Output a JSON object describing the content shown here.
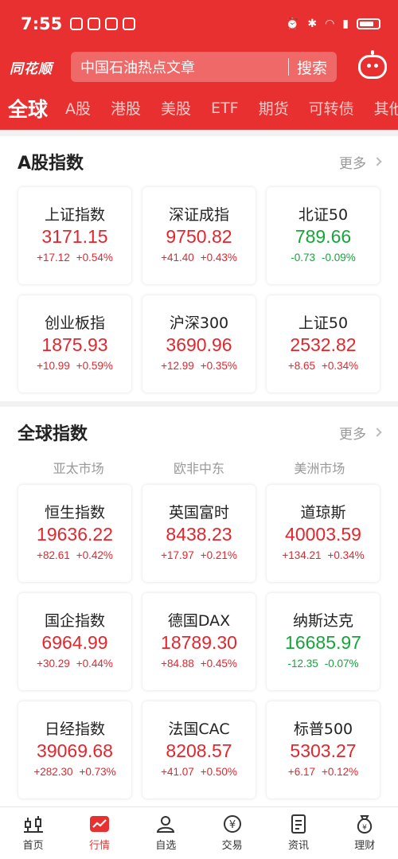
{
  "status_bar": {
    "time": "7:55"
  },
  "header": {
    "logo": "同花顺",
    "search_placeholder": "中国石油热点文章",
    "search_button": "搜索"
  },
  "tabs": [
    "全球",
    "A股",
    "港股",
    "美股",
    "ETF",
    "期货",
    "可转债",
    "其他"
  ],
  "a_share": {
    "title": "A股指数",
    "more": "更多",
    "cards": [
      {
        "name": "上证指数",
        "value": "3171.15",
        "change": "+17.12",
        "pct": "+0.54%",
        "dir": "up"
      },
      {
        "name": "深证成指",
        "value": "9750.82",
        "change": "+41.40",
        "pct": "+0.43%",
        "dir": "up"
      },
      {
        "name": "北证50",
        "value": "789.66",
        "change": "-0.73",
        "pct": "-0.09%",
        "dir": "down"
      },
      {
        "name": "创业板指",
        "value": "1875.93",
        "change": "+10.99",
        "pct": "+0.59%",
        "dir": "up"
      },
      {
        "name": "沪深300",
        "value": "3690.96",
        "change": "+12.99",
        "pct": "+0.35%",
        "dir": "up"
      },
      {
        "name": "上证50",
        "value": "2532.82",
        "change": "+8.65",
        "pct": "+0.34%",
        "dir": "up"
      }
    ]
  },
  "global": {
    "title": "全球指数",
    "more": "更多",
    "regions": [
      "亚太市场",
      "欧非中东",
      "美洲市场"
    ],
    "cards": [
      {
        "name": "恒生指数",
        "value": "19636.22",
        "change": "+82.61",
        "pct": "+0.42%",
        "dir": "up"
      },
      {
        "name": "英国富时",
        "value": "8438.23",
        "change": "+17.97",
        "pct": "+0.21%",
        "dir": "up"
      },
      {
        "name": "道琼斯",
        "value": "40003.59",
        "change": "+134.21",
        "pct": "+0.34%",
        "dir": "up"
      },
      {
        "name": "国企指数",
        "value": "6964.99",
        "change": "+30.29",
        "pct": "+0.44%",
        "dir": "up"
      },
      {
        "name": "德国DAX",
        "value": "18789.30",
        "change": "+84.88",
        "pct": "+0.45%",
        "dir": "up"
      },
      {
        "name": "纳斯达克",
        "value": "16685.97",
        "change": "-12.35",
        "pct": "-0.07%",
        "dir": "down"
      },
      {
        "name": "日经指数",
        "value": "39069.68",
        "change": "+282.30",
        "pct": "+0.73%",
        "dir": "up"
      },
      {
        "name": "法国CAC",
        "value": "8208.57",
        "change": "+41.07",
        "pct": "+0.50%",
        "dir": "up"
      },
      {
        "name": "标普500",
        "value": "5303.27",
        "change": "+6.17",
        "pct": "+0.12%",
        "dir": "up"
      }
    ]
  },
  "bottom_nav": [
    "首页",
    "行情",
    "自选",
    "交易",
    "资讯",
    "理财"
  ],
  "colors": {
    "brand": "#e93030",
    "up": "#e2262e",
    "down": "#15a53a"
  }
}
